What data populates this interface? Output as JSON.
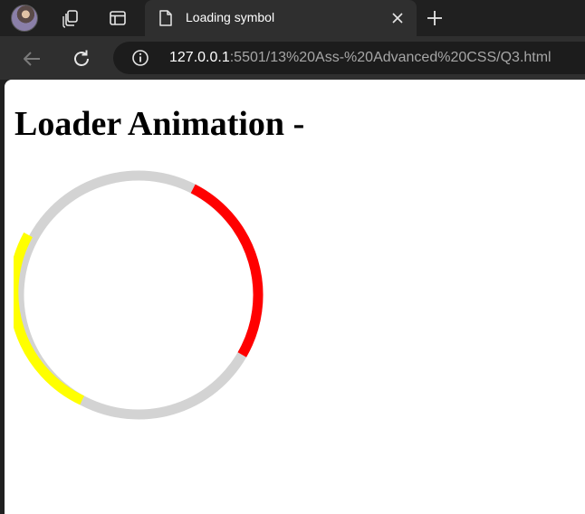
{
  "browser": {
    "tab": {
      "title": "Loading symbol"
    },
    "address_bar": {
      "url_host": "127.0.0.1",
      "url_rest": ":5501/13%20Ass-%20Advanced%20CSS/Q3.html"
    },
    "icons": {
      "avatar": "profile-avatar",
      "workspaces": "workspaces-icon",
      "tab_actions": "tab-actions-icon",
      "page": "page-icon",
      "close": "close-icon",
      "new_tab": "plus-icon",
      "back": "back-arrow-icon",
      "reload": "reload-icon",
      "info": "info-icon"
    },
    "colors": {
      "frame": "#202020",
      "toolbar": "#2f2f2f",
      "address_bg": "#1c1c1c"
    }
  },
  "page": {
    "heading": "Loader Animation -",
    "loader": {
      "colors": {
        "track": "#d3d3d3",
        "top_right": "#ff0000",
        "bottom_left": "#ffff00"
      }
    }
  }
}
